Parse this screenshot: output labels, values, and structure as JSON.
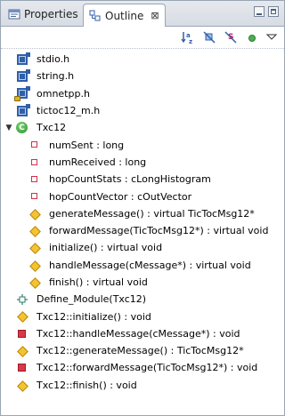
{
  "tabs": [
    {
      "label": "Properties",
      "icon": "properties-icon",
      "active": false
    },
    {
      "label": "Outline",
      "icon": "outline-icon",
      "active": true,
      "close": "⊠"
    }
  ],
  "toolbar": {
    "buttons": [
      "sort-az-icon",
      "hide-fields-icon",
      "hide-static-icon",
      "hide-nonpublic-icon",
      "view-menu-icon"
    ]
  },
  "tree": [
    {
      "label": "stdio.h",
      "icon": "header-icon",
      "depth": 0
    },
    {
      "label": "string.h",
      "icon": "header-icon",
      "depth": 0
    },
    {
      "label": "omnetpp.h",
      "icon": "header-locked-icon",
      "depth": 0
    },
    {
      "label": "tictoc12_m.h",
      "icon": "header-icon",
      "depth": 0
    },
    {
      "label": "Txc12",
      "icon": "class-icon",
      "depth": 0,
      "expanded": true
    },
    {
      "label": "numSent : long",
      "icon": "field-icon",
      "depth": 1
    },
    {
      "label": "numReceived : long",
      "icon": "field-icon",
      "depth": 1
    },
    {
      "label": "hopCountStats : cLongHistogram",
      "icon": "field-icon",
      "depth": 1
    },
    {
      "label": "hopCountVector : cOutVector",
      "icon": "field-icon",
      "depth": 1
    },
    {
      "label": "generateMessage() : virtual TicTocMsg12*",
      "icon": "method-icon",
      "depth": 1
    },
    {
      "label": "forwardMessage(TicTocMsg12*) : virtual void",
      "icon": "method-icon",
      "depth": 1
    },
    {
      "label": "initialize() : virtual void",
      "icon": "method-icon",
      "depth": 1
    },
    {
      "label": "handleMessage(cMessage*) : virtual void",
      "icon": "method-icon",
      "depth": 1
    },
    {
      "label": "finish() : virtual void",
      "icon": "method-icon",
      "depth": 1
    },
    {
      "label": "Define_Module(Txc12)",
      "icon": "macro-icon",
      "depth": 0
    },
    {
      "label": "Txc12::initialize() : void",
      "icon": "method-icon",
      "depth": 0
    },
    {
      "label": "Txc12::handleMessage(cMessage*) : void",
      "icon": "method-private-icon",
      "depth": 0
    },
    {
      "label": "Txc12::generateMessage() : TicTocMsg12*",
      "icon": "method-icon",
      "depth": 0
    },
    {
      "label": "Txc12::forwardMessage(TicTocMsg12*) : void",
      "icon": "method-private-icon",
      "depth": 0
    },
    {
      "label": "Txc12::finish() : void",
      "icon": "method-icon",
      "depth": 0
    }
  ]
}
